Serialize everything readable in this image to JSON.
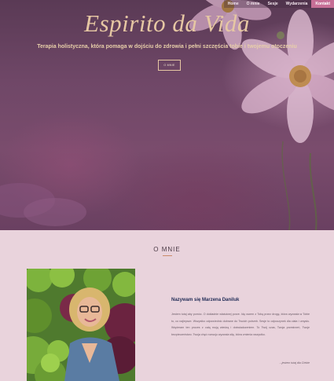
{
  "nav": {
    "items": [
      {
        "label": "Home",
        "active": false
      },
      {
        "label": "O mnie",
        "active": false
      },
      {
        "label": "Sesje",
        "active": false
      },
      {
        "label": "Wydarzenia",
        "active": false
      },
      {
        "label": "Kontakt",
        "active": true
      }
    ]
  },
  "hero": {
    "title": "Espirito da Vida",
    "tagline": "Terapia holistyczna, która pomaga w dojściu do zdrowia i pełni szczęścia tobie i twojemu otoczeniu",
    "button_label": "O MNIE"
  },
  "about": {
    "heading": "O MNIE",
    "name": "Nazywam się Marzena Daniluk",
    "bio": "Jestem tutaj aby pomóc. O dokładnie właściwej porze. Idę razem z Tobą przez drogę, która wyzwala w Tobie to, co najlepsze. Wszystko odpowiednio dobrane do Twoich potrzeb. Sesje to odpoczynek dla ciała i umysłu. Wspieram ten proces z całą moją wiedzą i doświadczeniem. To Twój czas, Twoja przestrzeń, Twoje bezpieczeństwo. Twoja chęć rozwoju wyzwala siłę, która zmienia wszystko.",
    "signature": "...jestem tutaj dla Ciebie"
  },
  "colors": {
    "accent": "#c76f96",
    "gold": "#e6c7a3",
    "about_bg": "#e9d3dc",
    "name": "#1f2a55"
  },
  "icons": [
    "cosmos-flower-image",
    "portrait-photo"
  ]
}
